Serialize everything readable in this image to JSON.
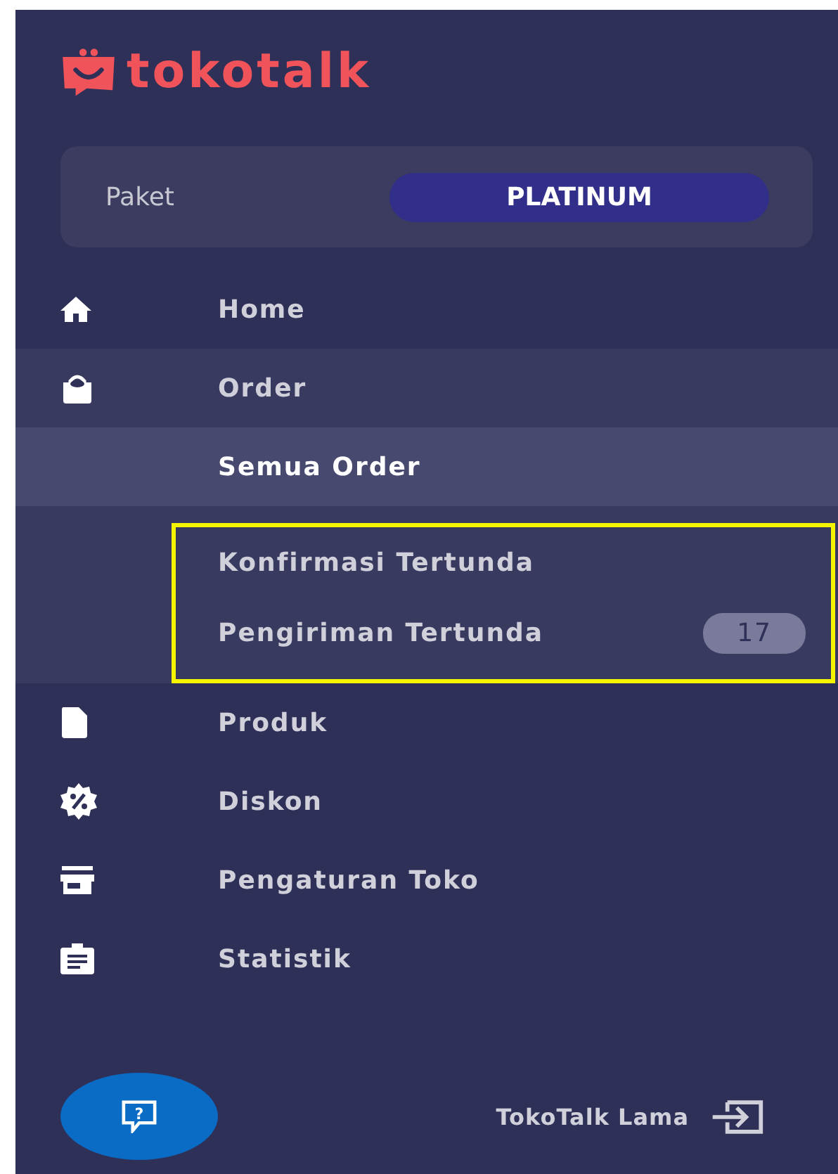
{
  "logo": {
    "text": "tokotalk"
  },
  "plan": {
    "label": "Paket",
    "value": "PLATINUM"
  },
  "menu": [
    {
      "label": "Home",
      "selected": false
    },
    {
      "label": "Order",
      "selected": false,
      "expanded": true,
      "children": [
        {
          "label": "Semua Order",
          "selected": true,
          "highlighted": false
        },
        {
          "label": "Konfirmasi Tertunda",
          "selected": false,
          "highlighted": true
        },
        {
          "label": "Pengiriman Tertunda",
          "selected": false,
          "highlighted": true,
          "badge": "17"
        }
      ]
    },
    {
      "label": "Produk",
      "selected": false
    },
    {
      "label": "Diskon",
      "selected": false
    },
    {
      "label": "Pengaturan Toko",
      "selected": false
    },
    {
      "label": "Statistik",
      "selected": false
    }
  ],
  "footer": {
    "help_icon": "?",
    "link": "TokoTalk Lama"
  }
}
